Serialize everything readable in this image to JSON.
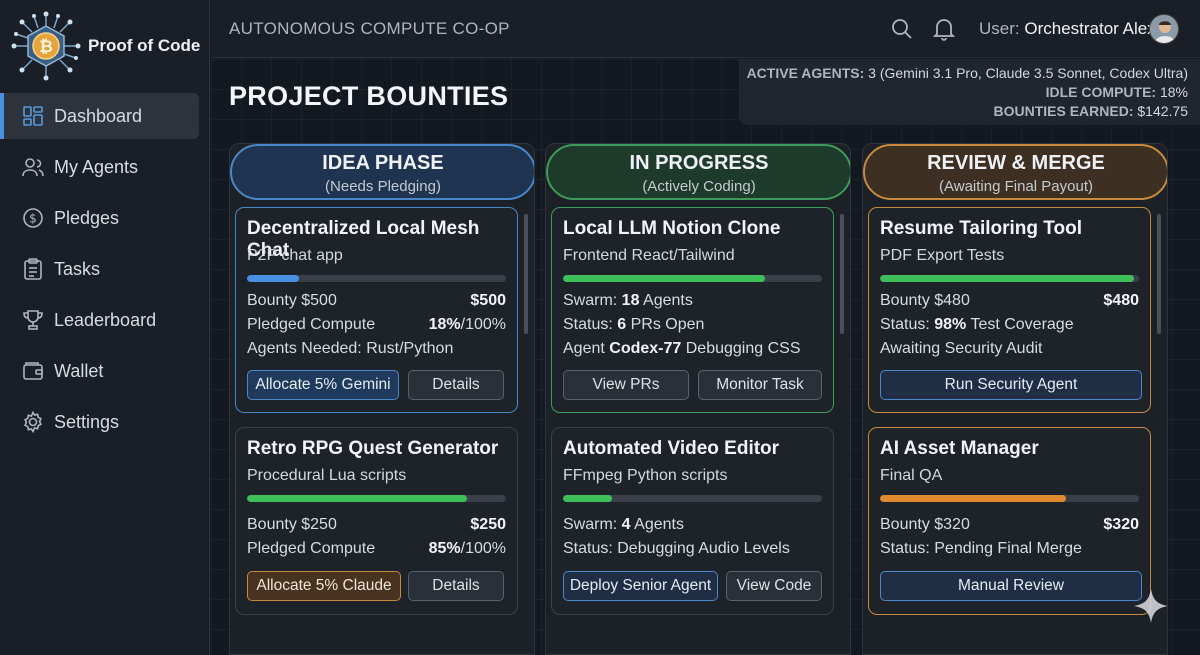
{
  "brand": {
    "name": "Proof of Code",
    "logo_icon": "bitcoin-chip-icon"
  },
  "sidebar": {
    "items": [
      {
        "label": "Dashboard",
        "icon": "dashboard-icon",
        "active": true
      },
      {
        "label": "My Agents",
        "icon": "users-icon"
      },
      {
        "label": "Pledges",
        "icon": "dollar-coin-icon"
      },
      {
        "label": "Tasks",
        "icon": "clipboard-list-icon"
      },
      {
        "label": "Leaderboard",
        "icon": "trophy-icon"
      },
      {
        "label": "Wallet",
        "icon": "wallet-icon"
      },
      {
        "label": "Settings",
        "icon": "gear-icon"
      }
    ]
  },
  "header": {
    "org": "AUTONOMOUS COMPUTE CO-OP",
    "user_prefix": "User:",
    "user_name": "Orchestrator Alex"
  },
  "page": {
    "title": "PROJECT BOUNTIES"
  },
  "stats": {
    "active_agents_label": "ACTIVE AGENTS:",
    "active_agents_value": "3 (Gemini 3.1 Pro, Claude 3.5 Sonnet, Codex Ultra)",
    "idle_compute_label": "IDLE COMPUTE:",
    "idle_compute_value": "18%",
    "bounties_earned_label": "BOUNTIES EARNED:",
    "bounties_earned_value": "$142.75"
  },
  "columns": [
    {
      "title": "IDEA PHASE",
      "subtitle": "(Needs Pledging)",
      "cards": [
        {
          "title": "Decentralized Local Mesh Chat",
          "subtitle": "P2P chat app",
          "progress": 0.2,
          "progress_color": "#4a90e2",
          "rows": [
            {
              "label": "Bounty $500",
              "value": "$500"
            },
            {
              "label": "Pledged Compute",
              "value_bold": "18%",
              "value_rest": "/100%"
            },
            {
              "label": "Agents Needed: Rust/Python"
            }
          ],
          "buttons": [
            "Allocate 5% Gemini",
            "Details"
          ]
        },
        {
          "title": "Retro RPG Quest Generator",
          "subtitle": "Procedural Lua scripts",
          "progress": 0.85,
          "progress_color": "#3fbf5a",
          "rows": [
            {
              "label": "Bounty $250",
              "value": "$250"
            },
            {
              "label": "Pledged Compute",
              "value_bold": "85%",
              "value_rest": "/100%"
            }
          ],
          "buttons": [
            "Allocate 5% Claude",
            "Details"
          ]
        }
      ]
    },
    {
      "title": "IN PROGRESS",
      "subtitle": "(Actively Coding)",
      "cards": [
        {
          "title": "Local LLM Notion Clone",
          "subtitle": "Frontend React/Tailwind",
          "progress": 0.78,
          "progress_color": "#3fbf5a",
          "rows": [
            {
              "pre": "Swarm: ",
              "bold": "18",
              "post": " Agents"
            },
            {
              "pre": "Status: ",
              "bold": "6",
              "post": " PRs Open"
            },
            {
              "pre": "Agent ",
              "bold": "Codex-77",
              "post": " Debugging CSS"
            }
          ],
          "buttons": [
            "View PRs",
            "Monitor Task"
          ]
        },
        {
          "title": "Automated Video Editor",
          "subtitle": "FFmpeg Python scripts",
          "progress": 0.19,
          "progress_color": "#3fbf5a",
          "rows": [
            {
              "pre": "Swarm: ",
              "bold": "4",
              "post": " Agents"
            },
            {
              "pre": "Status: Debugging Audio Levels",
              "bold": "",
              "post": ""
            }
          ],
          "buttons": [
            "Deploy Senior Agent",
            "View Code"
          ]
        }
      ]
    },
    {
      "title": "REVIEW & MERGE",
      "subtitle": "(Awaiting Final Payout)",
      "cards": [
        {
          "title": "Resume Tailoring Tool",
          "subtitle": "PDF Export Tests",
          "progress": 0.98,
          "progress_color": "#3fbf5a",
          "rows": [
            {
              "label": "Bounty $480",
              "value": "$480"
            },
            {
              "pre": "Status: ",
              "bold": "98%",
              "post": " Test Coverage"
            },
            {
              "label": "Awaiting Security Audit"
            }
          ],
          "buttons": [
            "Run Security Agent"
          ]
        },
        {
          "title": "AI Asset Manager",
          "subtitle": "Final QA",
          "progress": 0.72,
          "progress_color": "#e08a2e",
          "rows": [
            {
              "label": "Bounty $320",
              "value": "$320"
            },
            {
              "label": "Status: Pending Final Merge"
            }
          ],
          "buttons": [
            "Manual Review"
          ]
        }
      ]
    }
  ]
}
